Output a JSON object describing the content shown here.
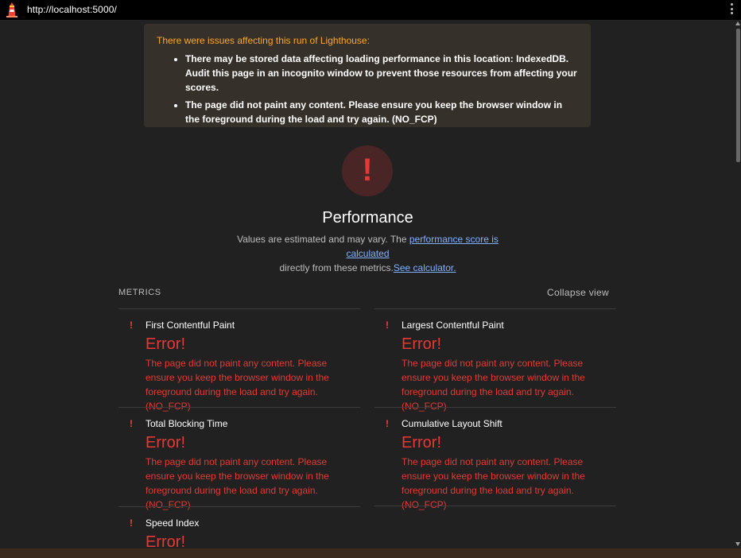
{
  "browser": {
    "url": "http://localhost:5000/",
    "logo_icon": "lighthouse-icon",
    "menu_icon": "kebab-menu-icon"
  },
  "warnings": {
    "title": "There were issues affecting this run of Lighthouse:",
    "items": [
      "There may be stored data affecting loading performance in this location: IndexedDB. Audit this page in an incognito window to prevent those resources from affecting your scores.",
      "The page did not paint any content. Please ensure you keep the browser window in the foreground during the load and try again. (NO_FCP)"
    ]
  },
  "gauge": {
    "symbol": "!",
    "status_color": "#e53935"
  },
  "performance": {
    "title": "Performance",
    "desc_prefix": "Values are estimated and may vary. The ",
    "score_link": "performance score is calculated",
    "desc_middle": "directly from these metrics.",
    "calculator_link": "See calculator."
  },
  "metrics": {
    "header": "METRICS",
    "collapse_label": "Collapse view",
    "error_symbol": "!",
    "items": [
      {
        "name": "First Contentful Paint",
        "value": "Error!",
        "message": "The page did not paint any content. Please ensure you keep the browser window in the foreground during the load and try again. (NO_FCP)"
      },
      {
        "name": "Largest Contentful Paint",
        "value": "Error!",
        "message": "The page did not paint any content. Please ensure you keep the browser window in the foreground during the load and try again. (NO_FCP)"
      },
      {
        "name": "Total Blocking Time",
        "value": "Error!",
        "message": "The page did not paint any content. Please ensure you keep the browser window in the foreground during the load and try again. (NO_FCP)"
      },
      {
        "name": "Cumulative Layout Shift",
        "value": "Error!",
        "message": "The page did not paint any content. Please ensure you keep the browser window in the foreground during the load and try again. (NO_FCP)"
      },
      {
        "name": "Speed Index",
        "value": "Error!",
        "message": ""
      }
    ]
  }
}
